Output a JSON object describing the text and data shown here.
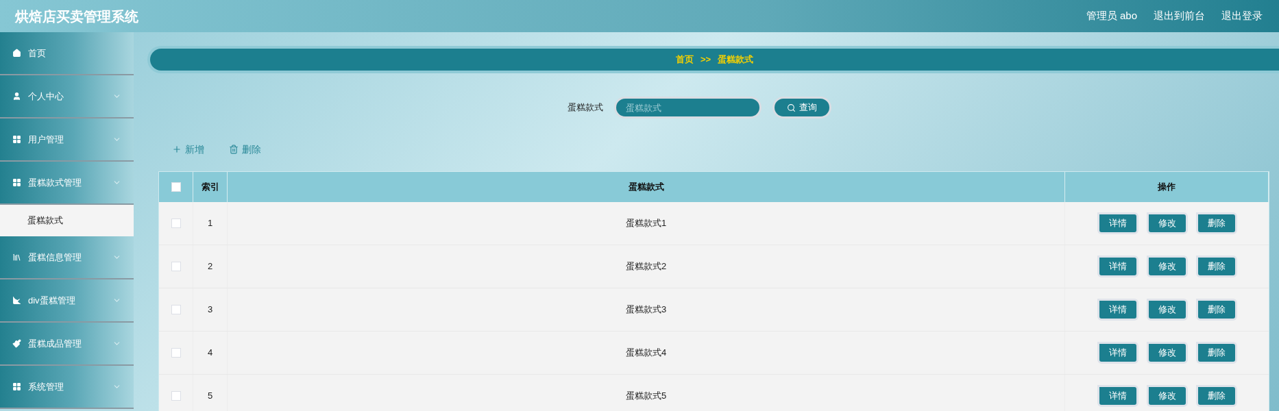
{
  "header": {
    "title": "烘焙店买卖管理系统",
    "links": [
      "管理员 abo",
      "退出到前台",
      "退出登录"
    ]
  },
  "sidebar": {
    "items": [
      {
        "label": "首页",
        "expandable": false
      },
      {
        "label": "个人中心",
        "expandable": true
      },
      {
        "label": "用户管理",
        "expandable": true
      },
      {
        "label": "蛋糕款式管理",
        "expandable": true,
        "children": [
          {
            "label": "蛋糕款式",
            "selected": true
          }
        ]
      },
      {
        "label": "蛋糕信息管理",
        "expandable": true
      },
      {
        "label": "div蛋糕管理",
        "expandable": true
      },
      {
        "label": "蛋糕成品管理",
        "expandable": true
      },
      {
        "label": "系统管理",
        "expandable": true
      }
    ]
  },
  "breadcrumb": [
    "首页",
    ">>",
    "蛋糕款式"
  ],
  "search": {
    "label": "蛋糕款式",
    "placeholder": "蛋糕款式",
    "button": "查询"
  },
  "toolbar": [
    {
      "label": "新增",
      "kind": "add"
    },
    {
      "label": "删除",
      "kind": "delete"
    }
  ],
  "table": {
    "select_all": {
      "checked": false
    },
    "columns": [
      "索引",
      "蛋糕款式",
      "操作"
    ],
    "rows": [
      {
        "checked": false,
        "index": "1",
        "name": "蛋糕款式1",
        "actions": [
          "详情",
          "修改",
          "删除"
        ]
      },
      {
        "checked": false,
        "index": "2",
        "name": "蛋糕款式2",
        "actions": [
          "详情",
          "修改",
          "删除"
        ]
      },
      {
        "checked": false,
        "index": "3",
        "name": "蛋糕款式3",
        "actions": [
          "详情",
          "修改",
          "删除"
        ]
      },
      {
        "checked": false,
        "index": "4",
        "name": "蛋糕款式4",
        "actions": [
          "详情",
          "修改",
          "删除"
        ]
      },
      {
        "checked": false,
        "index": "5",
        "name": "蛋糕款式5",
        "actions": [
          "详情",
          "修改",
          "删除"
        ]
      }
    ]
  }
}
